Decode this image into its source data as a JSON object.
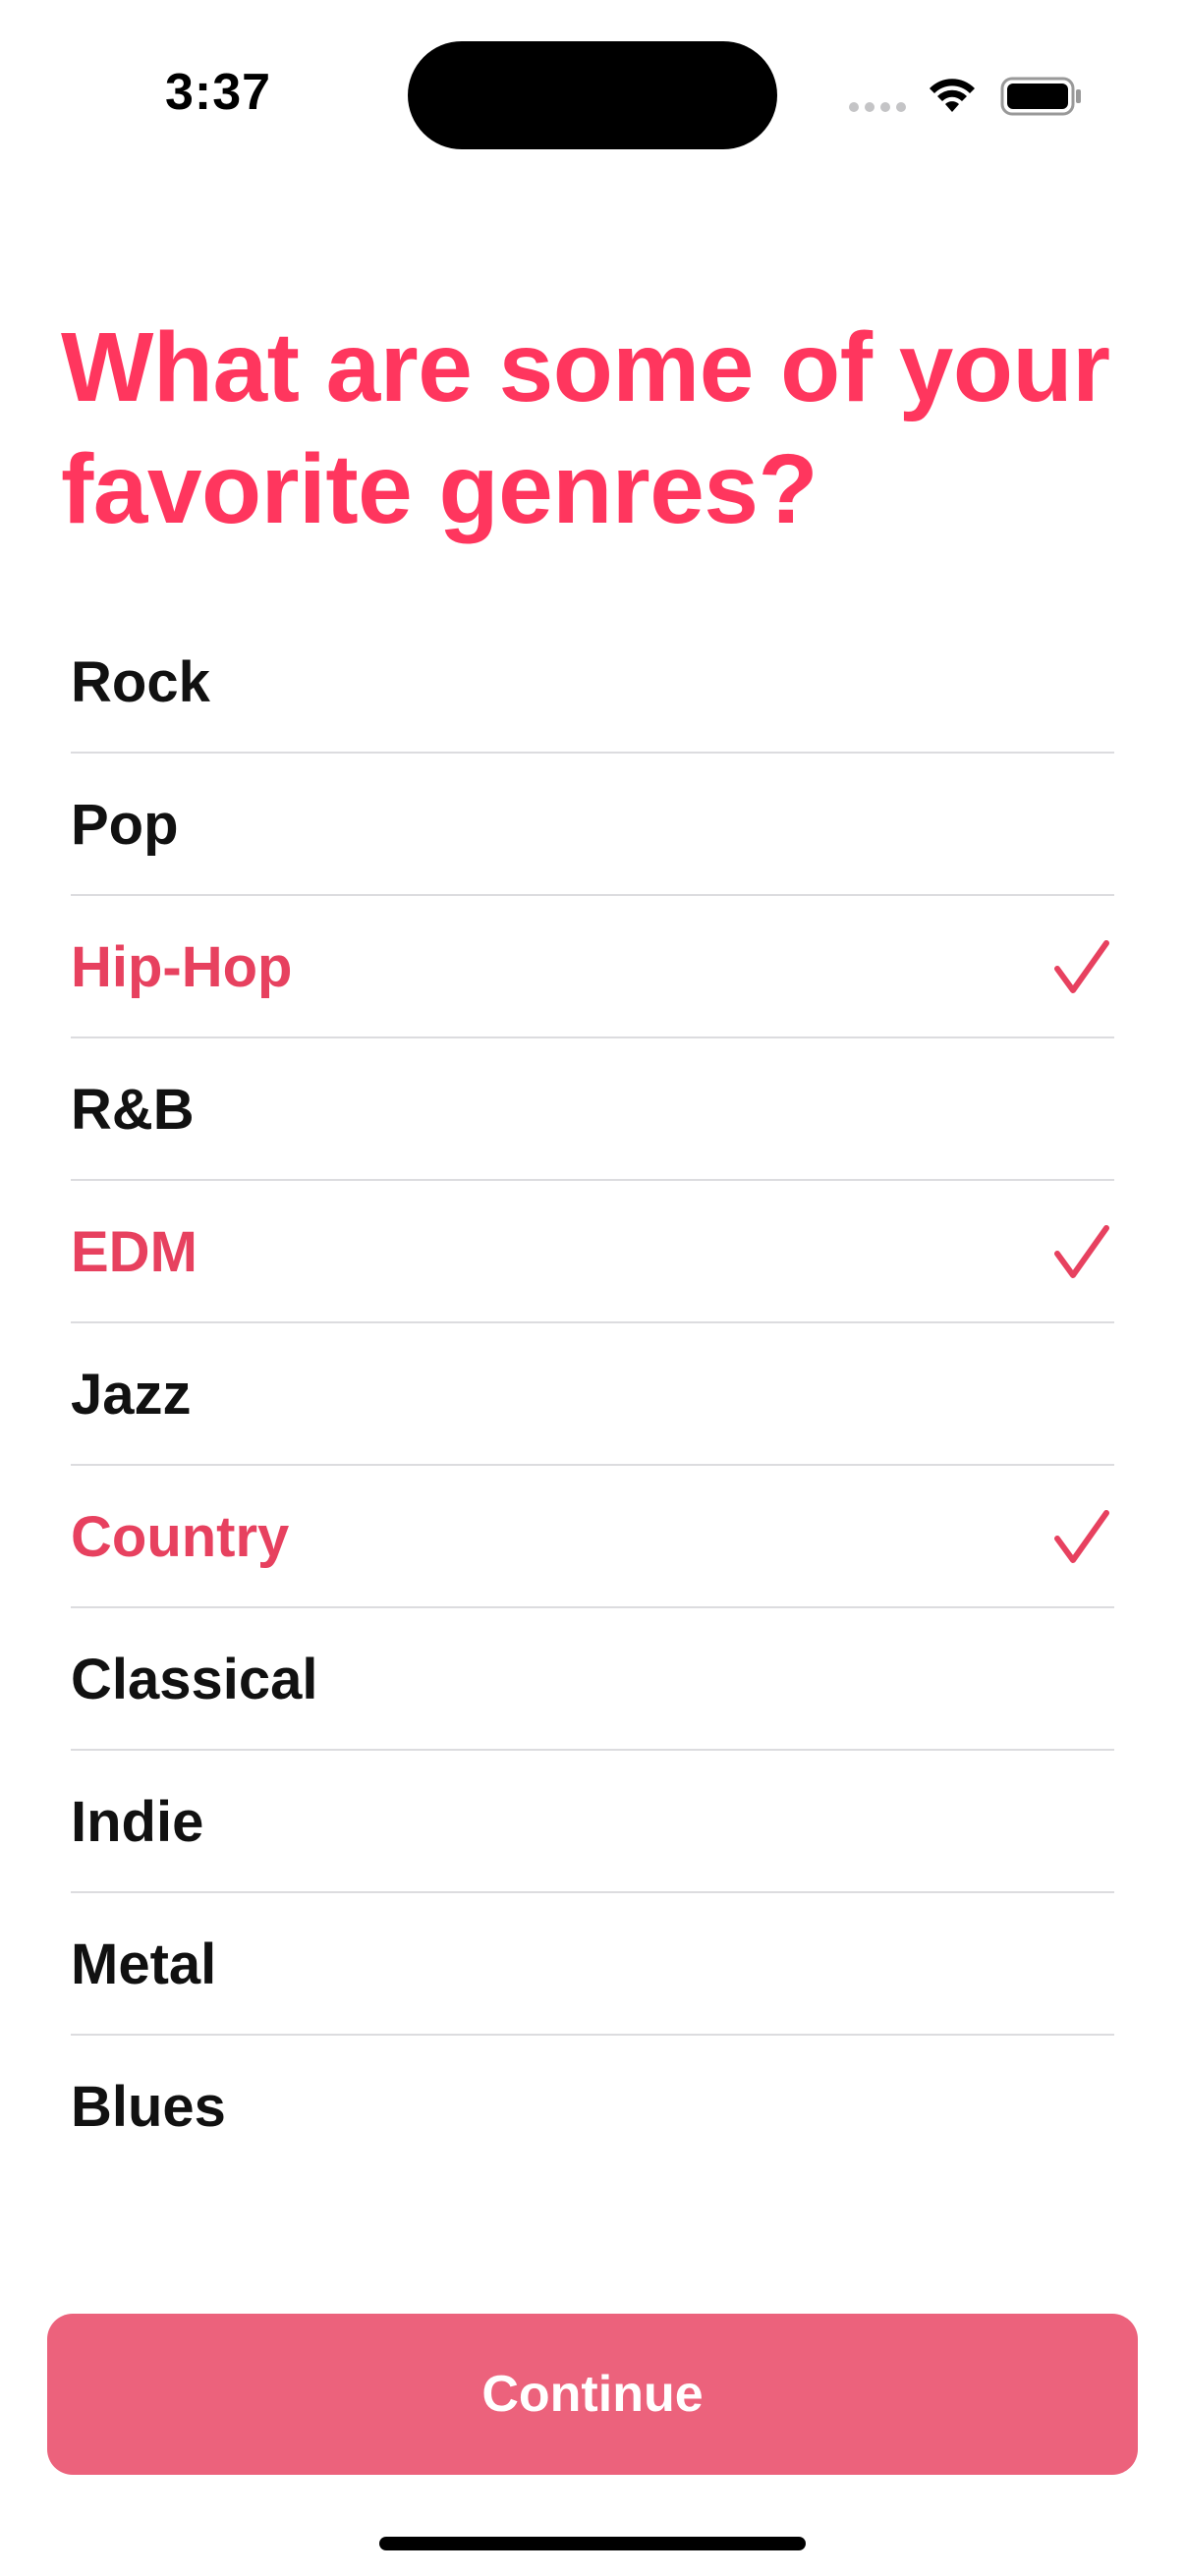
{
  "status_bar": {
    "time": "3:37",
    "wifi_icon": "wifi-icon",
    "battery_icon": "battery-icon"
  },
  "title": "What are some of your favorite genres?",
  "accent_color": "#ff365e",
  "genres": [
    {
      "label": "Rock",
      "selected": false
    },
    {
      "label": "Pop",
      "selected": false
    },
    {
      "label": "Hip-Hop",
      "selected": true
    },
    {
      "label": "R&B",
      "selected": false
    },
    {
      "label": "EDM",
      "selected": true
    },
    {
      "label": "Jazz",
      "selected": false
    },
    {
      "label": "Country",
      "selected": true
    },
    {
      "label": "Classical",
      "selected": false
    },
    {
      "label": "Indie",
      "selected": false
    },
    {
      "label": "Metal",
      "selected": false
    },
    {
      "label": "Blues",
      "selected": false
    }
  ],
  "continue_label": "Continue"
}
